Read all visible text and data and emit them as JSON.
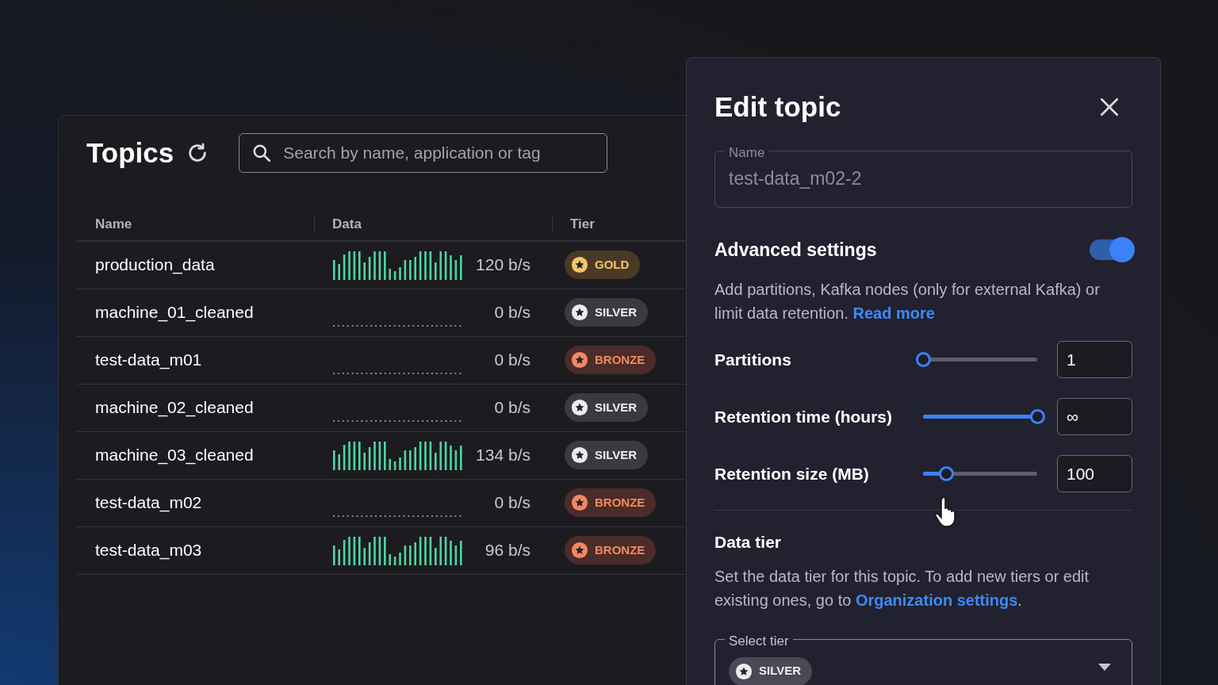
{
  "topics_window": {
    "title": "Topics",
    "search": {
      "placeholder": "Search by name, application or tag"
    },
    "columns": [
      "Name",
      "Data",
      "Tier"
    ],
    "rows": [
      {
        "name": "production_data",
        "active": true,
        "rate": "120 b/s",
        "tier": {
          "kind": "gold",
          "label": "GOLD"
        }
      },
      {
        "name": "machine_01_cleaned",
        "active": false,
        "rate": "0 b/s",
        "tier": {
          "kind": "silver",
          "label": "SILVER"
        }
      },
      {
        "name": "test-data_m01",
        "active": false,
        "rate": "0 b/s",
        "tier": {
          "kind": "bronze",
          "label": "BRONZE"
        }
      },
      {
        "name": "machine_02_cleaned",
        "active": false,
        "rate": "0 b/s",
        "tier": {
          "kind": "silver",
          "label": "SILVER"
        }
      },
      {
        "name": "machine_03_cleaned",
        "active": true,
        "rate": "134 b/s",
        "tier": {
          "kind": "silver",
          "label": "SILVER"
        }
      },
      {
        "name": "test-data_m02",
        "active": false,
        "rate": "0 b/s",
        "tier": {
          "kind": "bronze",
          "label": "BRONZE"
        }
      },
      {
        "name": "test-data_m03",
        "active": true,
        "rate": "96 b/s",
        "tier": {
          "kind": "bronze",
          "label": "BRONZE"
        }
      }
    ]
  },
  "edit_panel": {
    "title": "Edit topic",
    "name_field": {
      "label": "Name",
      "value": "test-data_m02-2",
      "disabled": true
    },
    "advanced": {
      "title": "Advanced settings",
      "on": true,
      "description": "Add partitions, Kafka nodes (only for external Kafka) or limit data retention.",
      "link": "Read more"
    },
    "sliders": [
      {
        "label": "Partitions",
        "level": 0,
        "value": "1"
      },
      {
        "label": "Retention time (hours)",
        "level": 1,
        "value": "∞"
      },
      {
        "label": "Retention size (MB)",
        "level": 0.2,
        "value": "100"
      }
    ],
    "data_tier": {
      "title": "Data tier",
      "description": "Set the data tier for this topic. To add new tiers or edit existing ones, go to",
      "link": "Organization settings",
      "after": ".",
      "select": {
        "label": "Select tier",
        "value": {
          "kind": "silver",
          "label": "SILVER"
        }
      }
    }
  }
}
